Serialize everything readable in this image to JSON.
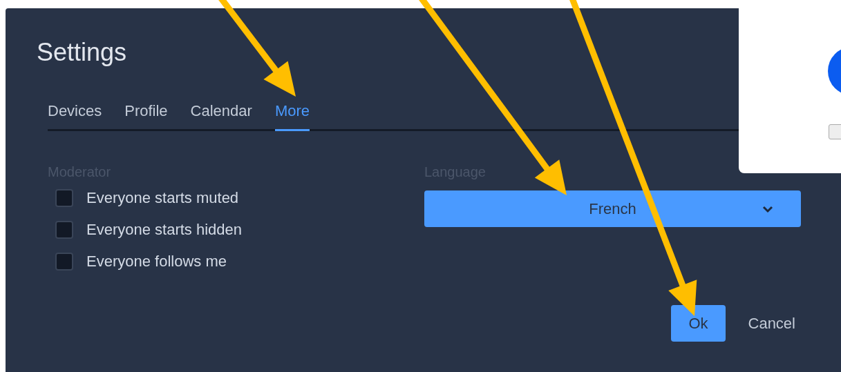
{
  "dialog": {
    "title": "Settings",
    "tabs": [
      {
        "label": "Devices",
        "selected": false
      },
      {
        "label": "Profile",
        "selected": false
      },
      {
        "label": "Calendar",
        "selected": false
      },
      {
        "label": "More",
        "selected": true
      }
    ],
    "moderator": {
      "label": "Moderator",
      "options": [
        {
          "label": "Everyone starts muted",
          "checked": false
        },
        {
          "label": "Everyone starts hidden",
          "checked": false
        },
        {
          "label": "Everyone follows me",
          "checked": false
        }
      ]
    },
    "language": {
      "label": "Language",
      "value": "French"
    },
    "buttons": [
      {
        "label": "Ok",
        "kind": "primary"
      },
      {
        "label": "Cancel",
        "kind": "plain"
      }
    ]
  },
  "popup": {
    "checkbox": {
      "checked": false
    }
  }
}
